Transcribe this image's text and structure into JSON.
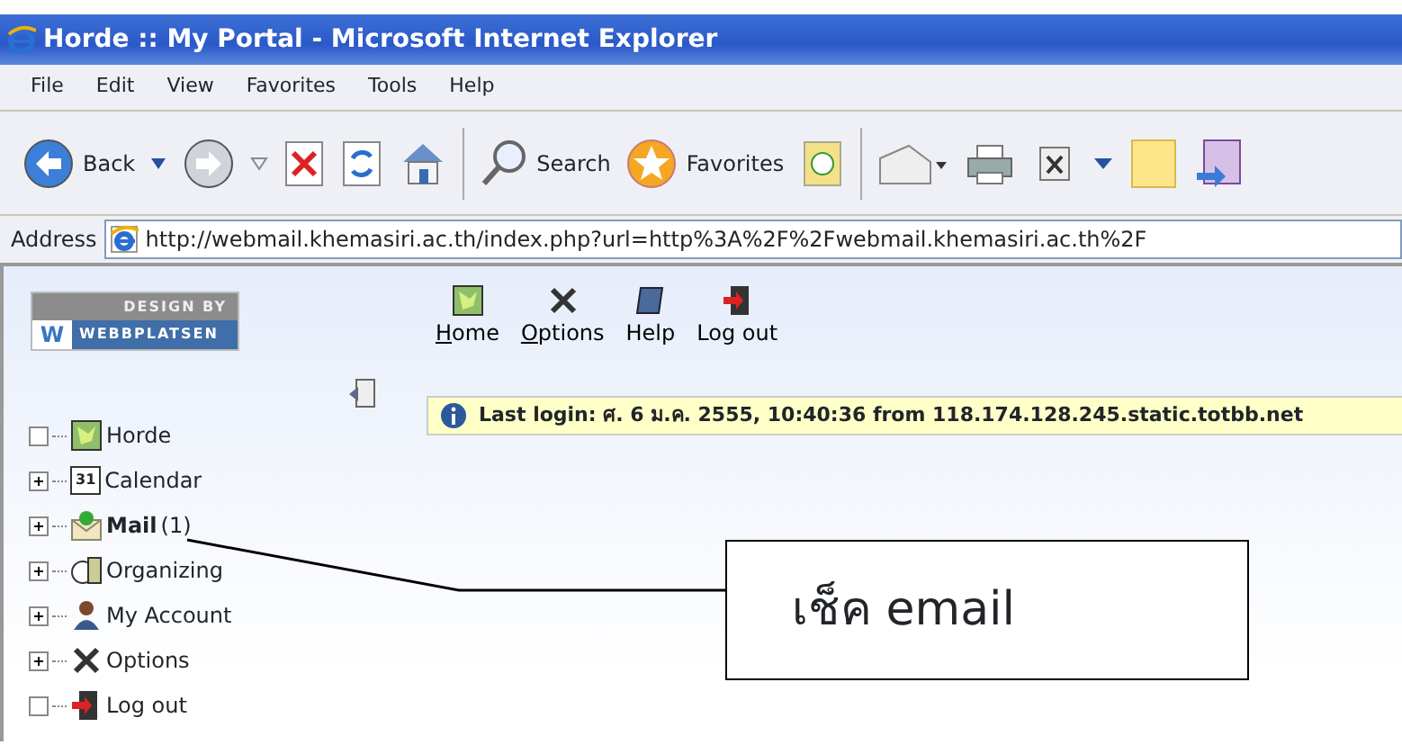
{
  "window": {
    "title": "Horde :: My Portal - Microsoft Internet Explorer"
  },
  "menu": [
    "File",
    "Edit",
    "View",
    "Favorites",
    "Tools",
    "Help"
  ],
  "toolbar": {
    "back_label": "Back",
    "search_label": "Search",
    "favorites_label": "Favorites"
  },
  "address": {
    "label": "Address",
    "url": "http://webmail.khemasiri.ac.th/index.php?url=http%3A%2F%2Fwebmail.khemasiri.ac.th%2F"
  },
  "logo": {
    "top": "DESIGN BY",
    "letter": "W",
    "name": "WEBBPLATSEN"
  },
  "portal_nav": [
    {
      "label": "Home",
      "underline_first": true
    },
    {
      "label": "Options",
      "underline_first": true
    },
    {
      "label": "Help",
      "underline_first": false
    },
    {
      "label": "Log out",
      "underline_first": false
    }
  ],
  "last_login": "Last login: ศ. 6 ม.ค. 2555, 10:40:36 from 118.174.128.245.static.totbb.net",
  "tree": [
    {
      "label": "Horde",
      "kind": "leaf",
      "bold": false
    },
    {
      "label": "Calendar",
      "kind": "branch",
      "bold": false,
      "icon_text": "31"
    },
    {
      "label": "Mail",
      "kind": "branch",
      "bold": true,
      "count": "(1)"
    },
    {
      "label": "Organizing",
      "kind": "branch",
      "bold": false
    },
    {
      "label": "My Account",
      "kind": "branch",
      "bold": false
    },
    {
      "label": "Options",
      "kind": "branch",
      "bold": false
    },
    {
      "label": "Log out",
      "kind": "leaf",
      "bold": false
    }
  ],
  "callout": {
    "text": "เช็ค email"
  }
}
